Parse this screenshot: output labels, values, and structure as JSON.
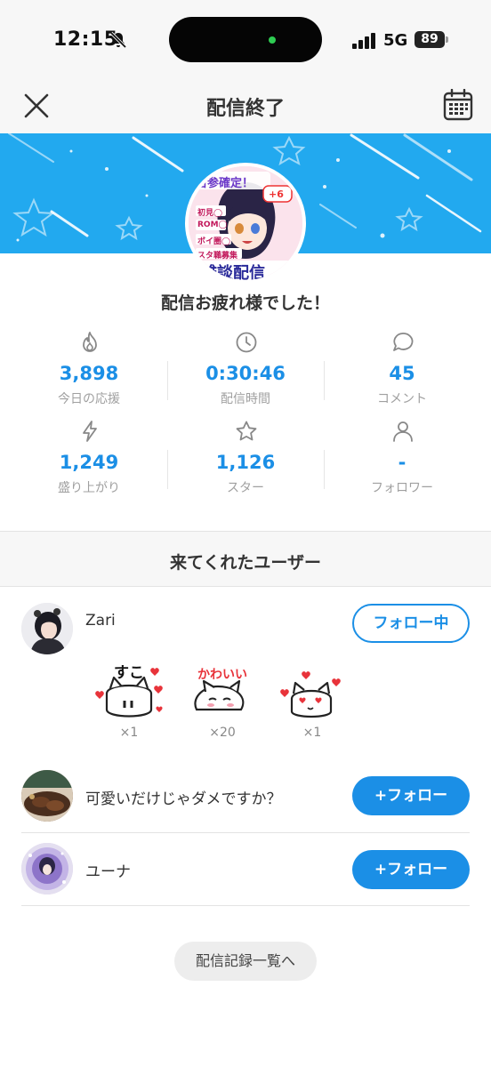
{
  "status_bar": {
    "time": "12:15",
    "network": "5G",
    "battery": "89"
  },
  "header": {
    "title": "配信終了",
    "close_icon": "close-icon",
    "calendar_icon": "calendar-icon"
  },
  "banner": {
    "accent_color": "#22a9ef",
    "thumbnail_text": {
      "line1": "古参確定！",
      "badge": "+6",
      "item1": "初見◯",
      "item2": "ROM◯",
      "item3": "ボイ圏◯",
      "item4": "スタ職募集",
      "main": "雑談配信"
    }
  },
  "message": "配信お疲れ様でした！",
  "stats": [
    {
      "icon": "flame-icon",
      "value": "3,898",
      "label": "今日の応援"
    },
    {
      "icon": "clock-icon",
      "value": "0:30:46",
      "label": "配信時間"
    },
    {
      "icon": "comment-icon",
      "value": "45",
      "label": "コメント"
    },
    {
      "icon": "lightning-icon",
      "value": "1,249",
      "label": "盛り上がり"
    },
    {
      "icon": "star-icon",
      "value": "1,126",
      "label": "スター"
    },
    {
      "icon": "person-icon",
      "value": "-",
      "label": "フォロワー"
    }
  ],
  "visitors": {
    "title": "来てくれたユーザー",
    "users": [
      {
        "name": "Zari",
        "button": "フォロー中",
        "stickers": [
          {
            "text": "すこ",
            "count": "×1"
          },
          {
            "text": "かわいい",
            "count": "×20"
          },
          {
            "text": "",
            "count": "×1"
          }
        ]
      },
      {
        "name": "可愛いだけじゃダメですか？",
        "button": "+フォロー"
      },
      {
        "name": "ユーナ",
        "button": "+フォロー"
      }
    ]
  },
  "footer": {
    "history_button": "配信記録一覧へ"
  },
  "colors": {
    "primary": "#1b8fe6",
    "muted": "#a0a0a0",
    "background": "#f7f7f7"
  }
}
